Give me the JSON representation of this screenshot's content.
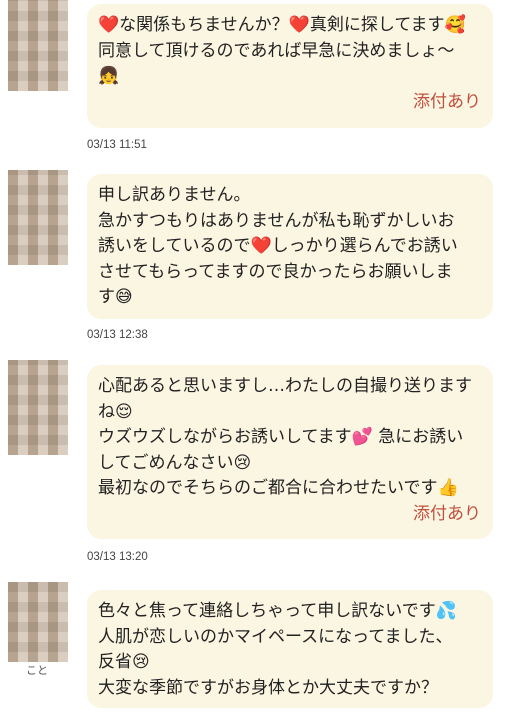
{
  "messages": [
    {
      "lines": [
        "❤️な関係もちませんか？❤️真剣に探してます🥰",
        "同意して頂けるのであれば早急に決めましょ〜",
        "👧"
      ],
      "attachment": "添付あり",
      "time": "03/13 11:51"
    },
    {
      "lines": [
        "申し訳ありません。",
        "急かすつもりはありませんが私も恥ずかしいお",
        "誘いをしているので❤️しっかり選らんでお誘い",
        "させてもらってますので良かったらお願いしま",
        "す😅"
      ],
      "attachment": "",
      "time": "03/13 12:38"
    },
    {
      "lines": [
        "心配あると思いますし…わたしの自撮り送ります",
        "ね😌",
        "ウズウズしながらお誘いしてます💕 急にお誘い",
        "してごめんなさい😢",
        "最初なのでそちらのご都合に合わせたいです👍"
      ],
      "attachment": "添付あり",
      "time": "03/13 13:20"
    },
    {
      "lines": [
        "色々と焦って連絡しちゃって申し訳ないです💦",
        "人肌が恋しいのかマイペースになってました、",
        "反省😢",
        "大変な季節ですがお身体とか大丈夫ですか？"
      ],
      "attachment": "",
      "time": ""
    }
  ],
  "avatar_caption": "こと",
  "colors": {
    "bubble": "#fbf6e2",
    "attachment_text": "#c0503f",
    "timestamp": "#444444"
  }
}
